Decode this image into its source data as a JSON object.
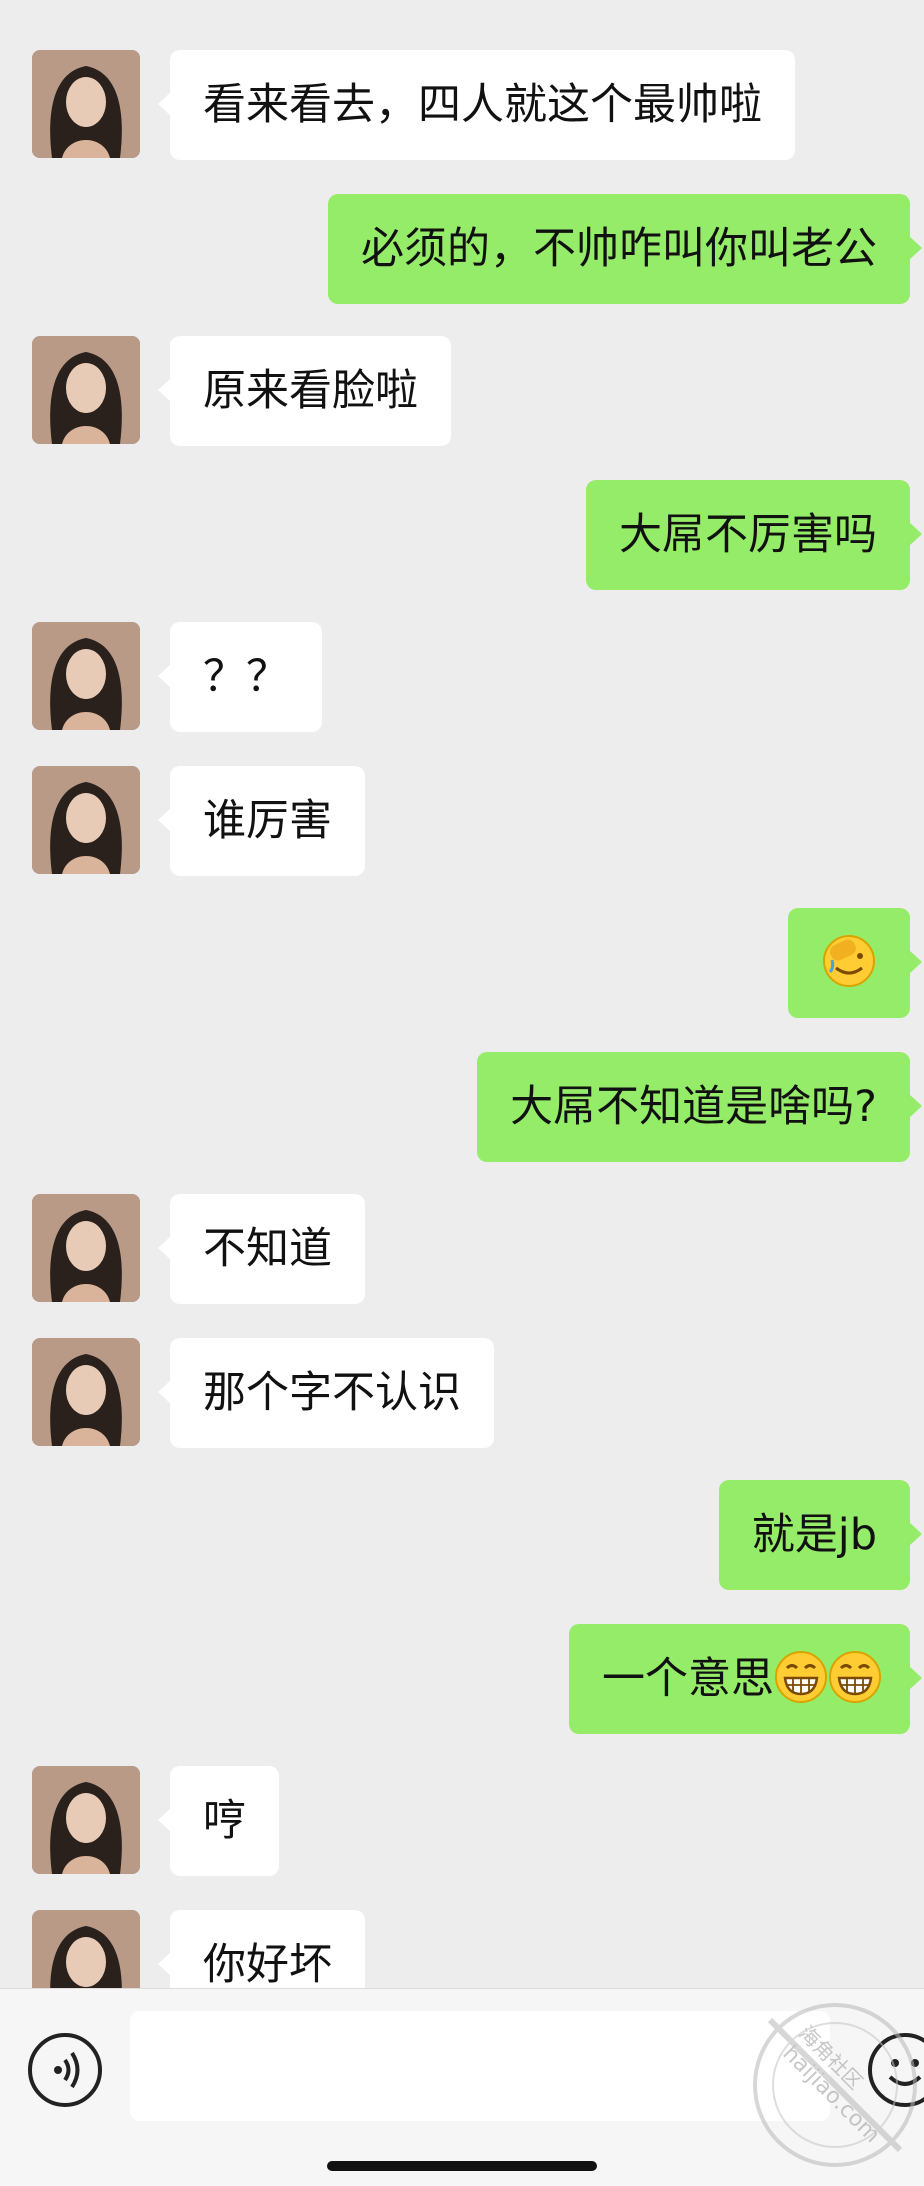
{
  "messages": [
    {
      "side": "in",
      "text": "看来看去，四人就这个最帅啦"
    },
    {
      "side": "out",
      "text": "必须的，不帅咋叫你叫老公"
    },
    {
      "side": "in",
      "text": "原来看脸啦"
    },
    {
      "side": "out",
      "text": "大屌不厉害吗"
    },
    {
      "side": "in",
      "text": "？？"
    },
    {
      "side": "in",
      "text": "谁厉害"
    },
    {
      "side": "out",
      "text": "",
      "emoji": "facepalm-emoji"
    },
    {
      "side": "out",
      "text": "大屌不知道是啥吗?"
    },
    {
      "side": "in",
      "text": "不知道"
    },
    {
      "side": "in",
      "text": "那个字不认识"
    },
    {
      "side": "out",
      "text": "就是jb"
    },
    {
      "side": "out",
      "text": "一个意思",
      "emoji_suffix": [
        "grin-emoji",
        "grin-emoji"
      ]
    },
    {
      "side": "in",
      "text": "哼"
    },
    {
      "side": "in",
      "text": "你好坏"
    }
  ],
  "input_bar": {
    "placeholder": "",
    "voice_icon": "voice-icon",
    "emoji_icon": "emoji-icon"
  },
  "watermark": {
    "line1": "海角社区",
    "line2": "haijiao.com"
  },
  "colors": {
    "background": "#ededed",
    "incoming_bubble": "#ffffff",
    "outgoing_bubble": "#95ec69"
  }
}
